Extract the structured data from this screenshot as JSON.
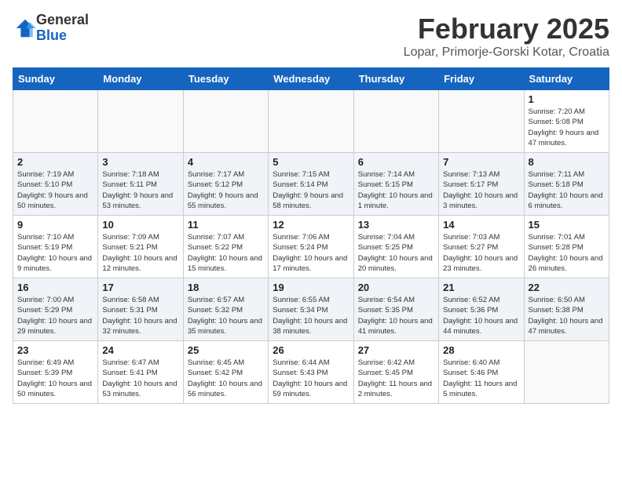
{
  "logo": {
    "general": "General",
    "blue": "Blue"
  },
  "header": {
    "month": "February 2025",
    "location": "Lopar, Primorje-Gorski Kotar, Croatia"
  },
  "weekdays": [
    "Sunday",
    "Monday",
    "Tuesday",
    "Wednesday",
    "Thursday",
    "Friday",
    "Saturday"
  ],
  "weeks": [
    [
      {
        "day": "",
        "info": ""
      },
      {
        "day": "",
        "info": ""
      },
      {
        "day": "",
        "info": ""
      },
      {
        "day": "",
        "info": ""
      },
      {
        "day": "",
        "info": ""
      },
      {
        "day": "",
        "info": ""
      },
      {
        "day": "1",
        "info": "Sunrise: 7:20 AM\nSunset: 5:08 PM\nDaylight: 9 hours and 47 minutes."
      }
    ],
    [
      {
        "day": "2",
        "info": "Sunrise: 7:19 AM\nSunset: 5:10 PM\nDaylight: 9 hours and 50 minutes."
      },
      {
        "day": "3",
        "info": "Sunrise: 7:18 AM\nSunset: 5:11 PM\nDaylight: 9 hours and 53 minutes."
      },
      {
        "day": "4",
        "info": "Sunrise: 7:17 AM\nSunset: 5:12 PM\nDaylight: 9 hours and 55 minutes."
      },
      {
        "day": "5",
        "info": "Sunrise: 7:15 AM\nSunset: 5:14 PM\nDaylight: 9 hours and 58 minutes."
      },
      {
        "day": "6",
        "info": "Sunrise: 7:14 AM\nSunset: 5:15 PM\nDaylight: 10 hours and 1 minute."
      },
      {
        "day": "7",
        "info": "Sunrise: 7:13 AM\nSunset: 5:17 PM\nDaylight: 10 hours and 3 minutes."
      },
      {
        "day": "8",
        "info": "Sunrise: 7:11 AM\nSunset: 5:18 PM\nDaylight: 10 hours and 6 minutes."
      }
    ],
    [
      {
        "day": "9",
        "info": "Sunrise: 7:10 AM\nSunset: 5:19 PM\nDaylight: 10 hours and 9 minutes."
      },
      {
        "day": "10",
        "info": "Sunrise: 7:09 AM\nSunset: 5:21 PM\nDaylight: 10 hours and 12 minutes."
      },
      {
        "day": "11",
        "info": "Sunrise: 7:07 AM\nSunset: 5:22 PM\nDaylight: 10 hours and 15 minutes."
      },
      {
        "day": "12",
        "info": "Sunrise: 7:06 AM\nSunset: 5:24 PM\nDaylight: 10 hours and 17 minutes."
      },
      {
        "day": "13",
        "info": "Sunrise: 7:04 AM\nSunset: 5:25 PM\nDaylight: 10 hours and 20 minutes."
      },
      {
        "day": "14",
        "info": "Sunrise: 7:03 AM\nSunset: 5:27 PM\nDaylight: 10 hours and 23 minutes."
      },
      {
        "day": "15",
        "info": "Sunrise: 7:01 AM\nSunset: 5:28 PM\nDaylight: 10 hours and 26 minutes."
      }
    ],
    [
      {
        "day": "16",
        "info": "Sunrise: 7:00 AM\nSunset: 5:29 PM\nDaylight: 10 hours and 29 minutes."
      },
      {
        "day": "17",
        "info": "Sunrise: 6:58 AM\nSunset: 5:31 PM\nDaylight: 10 hours and 32 minutes."
      },
      {
        "day": "18",
        "info": "Sunrise: 6:57 AM\nSunset: 5:32 PM\nDaylight: 10 hours and 35 minutes."
      },
      {
        "day": "19",
        "info": "Sunrise: 6:55 AM\nSunset: 5:34 PM\nDaylight: 10 hours and 38 minutes."
      },
      {
        "day": "20",
        "info": "Sunrise: 6:54 AM\nSunset: 5:35 PM\nDaylight: 10 hours and 41 minutes."
      },
      {
        "day": "21",
        "info": "Sunrise: 6:52 AM\nSunset: 5:36 PM\nDaylight: 10 hours and 44 minutes."
      },
      {
        "day": "22",
        "info": "Sunrise: 6:50 AM\nSunset: 5:38 PM\nDaylight: 10 hours and 47 minutes."
      }
    ],
    [
      {
        "day": "23",
        "info": "Sunrise: 6:49 AM\nSunset: 5:39 PM\nDaylight: 10 hours and 50 minutes."
      },
      {
        "day": "24",
        "info": "Sunrise: 6:47 AM\nSunset: 5:41 PM\nDaylight: 10 hours and 53 minutes."
      },
      {
        "day": "25",
        "info": "Sunrise: 6:45 AM\nSunset: 5:42 PM\nDaylight: 10 hours and 56 minutes."
      },
      {
        "day": "26",
        "info": "Sunrise: 6:44 AM\nSunset: 5:43 PM\nDaylight: 10 hours and 59 minutes."
      },
      {
        "day": "27",
        "info": "Sunrise: 6:42 AM\nSunset: 5:45 PM\nDaylight: 11 hours and 2 minutes."
      },
      {
        "day": "28",
        "info": "Sunrise: 6:40 AM\nSunset: 5:46 PM\nDaylight: 11 hours and 5 minutes."
      },
      {
        "day": "",
        "info": ""
      }
    ]
  ]
}
